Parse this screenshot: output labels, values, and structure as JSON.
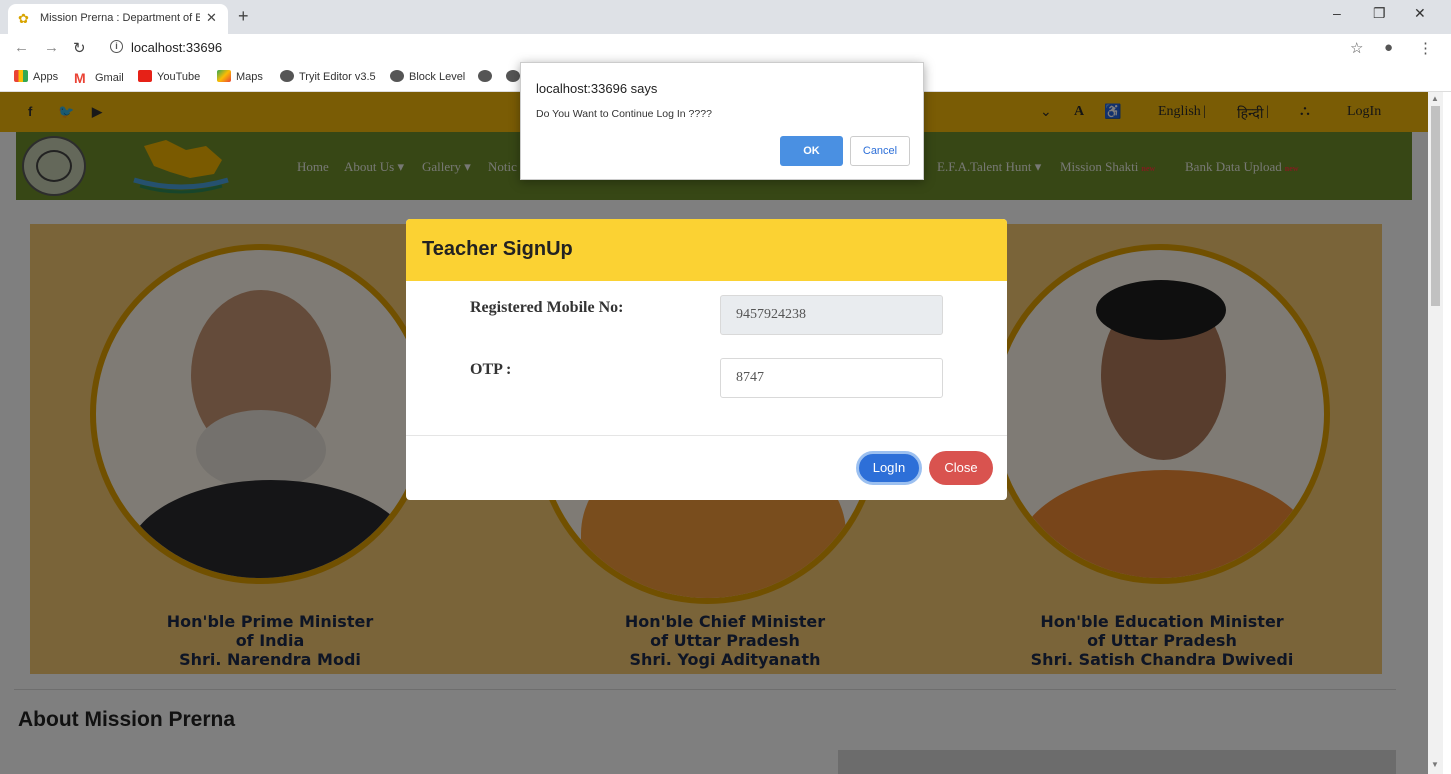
{
  "browser": {
    "tab_title": "Mission Prerna : Department of B",
    "tab_close": "✕",
    "new_tab": "+",
    "url": "localhost:33696",
    "info_icon": "i",
    "bookmarks": [
      {
        "label": "Apps",
        "icon": "apps-icon",
        "color": "#4285f4"
      },
      {
        "label": "Gmail",
        "icon": "gmail-icon",
        "color": "#ea4335"
      },
      {
        "label": "YouTube",
        "icon": "youtube-icon",
        "color": "#e62117"
      },
      {
        "label": "Maps",
        "icon": "maps-icon",
        "color": "#34a853"
      },
      {
        "label": "Tryit Editor v3.5",
        "icon": "globe-icon",
        "color": "#555555"
      },
      {
        "label": "Block Level",
        "icon": "globe-icon",
        "color": "#555555"
      }
    ]
  },
  "site": {
    "top_strip": {
      "font_label": "A",
      "accessibility_icon": "♿",
      "english": "English",
      "hindi": "हिन्दी",
      "sitemap_icon": "sitemap-icon",
      "login": "LogIn",
      "divider": "|"
    },
    "nav": [
      {
        "label": "Home",
        "dropdown": false
      },
      {
        "label": "About Us",
        "dropdown": true
      },
      {
        "label": "Gallery",
        "dropdown": true
      },
      {
        "label": "Notic",
        "dropdown": false
      }
    ],
    "nav_right": [
      {
        "label": "E.F.A.",
        "dropdown": false,
        "new": false
      },
      {
        "label": "Talent Hunt",
        "dropdown": true,
        "new": false
      },
      {
        "label": "Mission Shakti",
        "dropdown": false,
        "new": true
      },
      {
        "label": "Bank Data Upload",
        "dropdown": false,
        "new": true
      }
    ],
    "new_badge": "new",
    "leaders": [
      {
        "line1": "Hon'ble Prime Minister",
        "line2": "of India",
        "line3": "Shri. Narendra Modi"
      },
      {
        "line1": "Hon'ble Chief Minister",
        "line2": "of Uttar Pradesh",
        "line3": "Shri. Yogi Adityanath"
      },
      {
        "line1": "Hon'ble Education Minister",
        "line2": "of Uttar Pradesh",
        "line3": "Shri. Satish Chandra Dwivedi"
      }
    ],
    "about_title": "About Mission Prerna"
  },
  "modal": {
    "title": "Teacher SignUp",
    "mobile_label": "Registered Mobile No:",
    "mobile_value": "9457924238",
    "otp_label": "OTP :",
    "otp_value": "8747",
    "login_label": "LogIn",
    "close_label": "Close"
  },
  "alert": {
    "title": "localhost:33696 says",
    "message": "Do You Want to Continue Log In ????",
    "ok_label": "OK",
    "cancel_label": "Cancel"
  },
  "colors": {
    "top_strip": "#f5b90a",
    "navbar": "#6e8f2a",
    "modal_header": "#fbd233",
    "login_button": "#2d6fd8",
    "close_button": "#d9534f"
  }
}
